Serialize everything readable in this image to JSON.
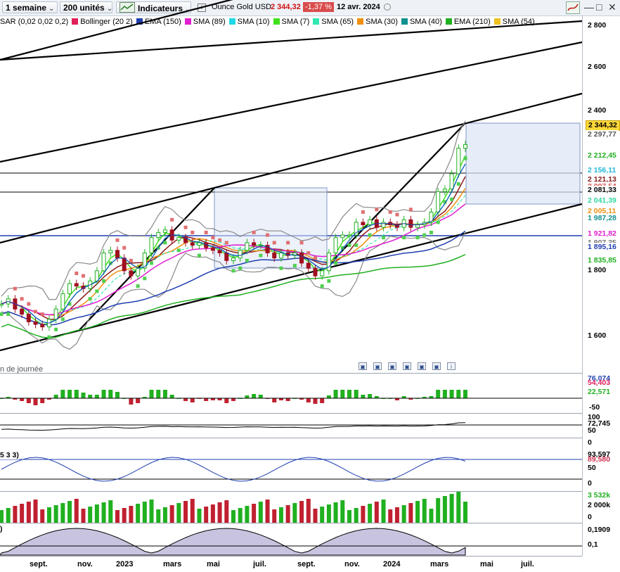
{
  "toolbar": {
    "period": "1 semaine",
    "units": "200 unités",
    "indicators_label": "Indicateurs",
    "instrument": "Ounce Gold USD",
    "price": "2 344,32",
    "change": "-1,37 %",
    "date": "12 avr. 2024"
  },
  "indicators": [
    {
      "label": "SAR (0,02 0,02 0,2)",
      "color": "#e05050"
    },
    {
      "label": "Bollinger (20 2)",
      "color": "#e0205a"
    },
    {
      "label": "EMA (150)",
      "color": "#1f3fb0"
    },
    {
      "label": "SMA (89)",
      "color": "#e020d0"
    },
    {
      "label": "SMA (10)",
      "color": "#20d8e8"
    },
    {
      "label": "SMA (7)",
      "color": "#40e020"
    },
    {
      "label": "SMA (65)",
      "color": "#30e8b0"
    },
    {
      "label": "SMA (30)",
      "color": "#f09010"
    },
    {
      "label": "SMA (40)",
      "color": "#109090"
    },
    {
      "label": "EMA (210)",
      "color": "#20b020"
    },
    {
      "label": "SMA (54)",
      "color": "#f0c020"
    }
  ],
  "price_axis": [
    "2 800",
    "2 600",
    "2 400",
    "1 800",
    "1 600"
  ],
  "price_tags": [
    {
      "text": "2 344,32",
      "color": "#000000",
      "bg": "#ffd83a"
    },
    {
      "text": "2 297,77",
      "color": "#555555",
      "bg": "#ffffff"
    },
    {
      "text": "2 212,45",
      "color": "#20b020",
      "bg": "#ffffff"
    },
    {
      "text": "2 156,11",
      "color": "#20b8d8",
      "bg": "#ffffff"
    },
    {
      "text": "2 121,13",
      "color": "#8b1a1a",
      "bg": "#ffffff"
    },
    {
      "text": "2 097,54",
      "color": "#e05050",
      "bg": "#ffffff"
    },
    {
      "text": "2 081,33",
      "color": "#000000",
      "bg": "#ffffff"
    },
    {
      "text": "2 041,39",
      "color": "#30d8a0",
      "bg": "#ffffff"
    },
    {
      "text": "2 005,11",
      "color": "#f09010",
      "bg": "#ffffff"
    },
    {
      "text": "1 987,28",
      "color": "#109090",
      "bg": "#ffffff"
    },
    {
      "text": "1 921,82",
      "color": "#e020d0",
      "bg": "#ffffff"
    },
    {
      "text": "1 907,35",
      "color": "#777777",
      "bg": "#ffffff"
    },
    {
      "text": "1 895,16",
      "color": "#1f3fb0",
      "bg": "#ffffff"
    },
    {
      "text": "1 835,85",
      "color": "#20b020",
      "bg": "#ffffff"
    }
  ],
  "note": "n de journée",
  "macd_axis": [
    "76,074",
    "54,403",
    "22,571",
    "-50"
  ],
  "rsi_axis": [
    "100",
    "72,745",
    "50",
    "0"
  ],
  "stoch_label": "5 3 3)",
  "stoch_axis": [
    "93,597",
    "89,580",
    "50",
    "0"
  ],
  "volume_axis": [
    "3 532k",
    "2 000k",
    "0"
  ],
  "last_panel_label": ")",
  "last_panel_axis": [
    "0,1909",
    "0,1"
  ],
  "x_labels": [
    "sept.",
    "nov.",
    "2023",
    "mars",
    "mai",
    "juil.",
    "sept.",
    "nov.",
    "2024",
    "mars",
    "mai",
    "juil."
  ],
  "chart_data": {
    "type": "candlestick",
    "instrument": "Ounce Gold USD",
    "last": 2344.32,
    "price_range": [
      1450,
      2850
    ],
    "weekly_close_samples": [
      1720,
      1740,
      1700,
      1680,
      1650,
      1640,
      1630,
      1660,
      1700,
      1760,
      1800,
      1790,
      1780,
      1810,
      1850,
      1920,
      1930,
      1900,
      1850,
      1830,
      1860,
      1920,
      1980,
      2000,
      2010,
      1970,
      1980,
      1960,
      1950,
      1960,
      1940,
      1930,
      1920,
      1890,
      1900,
      1930,
      1960,
      1950,
      1950,
      1920,
      1900,
      1920,
      1910,
      1920,
      1880,
      1860,
      1830,
      1850,
      1920,
      1980,
      1990,
      1990,
      2040,
      2030,
      2050,
      2020,
      2040,
      2030,
      2020,
      2050,
      2020,
      2030,
      2040,
      2080,
      2160,
      2170,
      2230,
      2330,
      2344
    ]
  }
}
